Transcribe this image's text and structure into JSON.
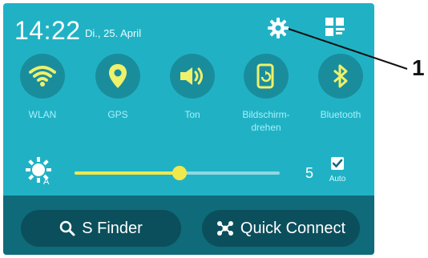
{
  "status": {
    "time": "14:22",
    "date": "Di., 25. April"
  },
  "toolbar": {
    "settings_icon": "gear-icon",
    "edit_icon": "grid-edit-icon"
  },
  "toggles": [
    {
      "label": "WLAN",
      "icon": "wifi-icon"
    },
    {
      "label": "GPS",
      "icon": "location-pin-icon"
    },
    {
      "label": "Ton",
      "icon": "speaker-icon"
    },
    {
      "label": "Bildschirm-\ndrehen",
      "icon": "screen-rotate-icon"
    },
    {
      "label": "Bluetooth",
      "icon": "bluetooth-icon"
    }
  ],
  "brightness": {
    "value": "5",
    "level_fraction": 0.51,
    "auto_label": "Auto",
    "auto_checked": true
  },
  "actions": {
    "s_finder": "S Finder",
    "quick_connect": "Quick Connect"
  },
  "callout": {
    "number": "1"
  },
  "colors": {
    "panel": "#20b2c4",
    "toggle_bg": "#1a8d9d",
    "active_icon": "#eef16a",
    "bottom_bar": "#0f6b7a",
    "pill": "#0b4f5c",
    "slider_active": "#f1e84c"
  }
}
